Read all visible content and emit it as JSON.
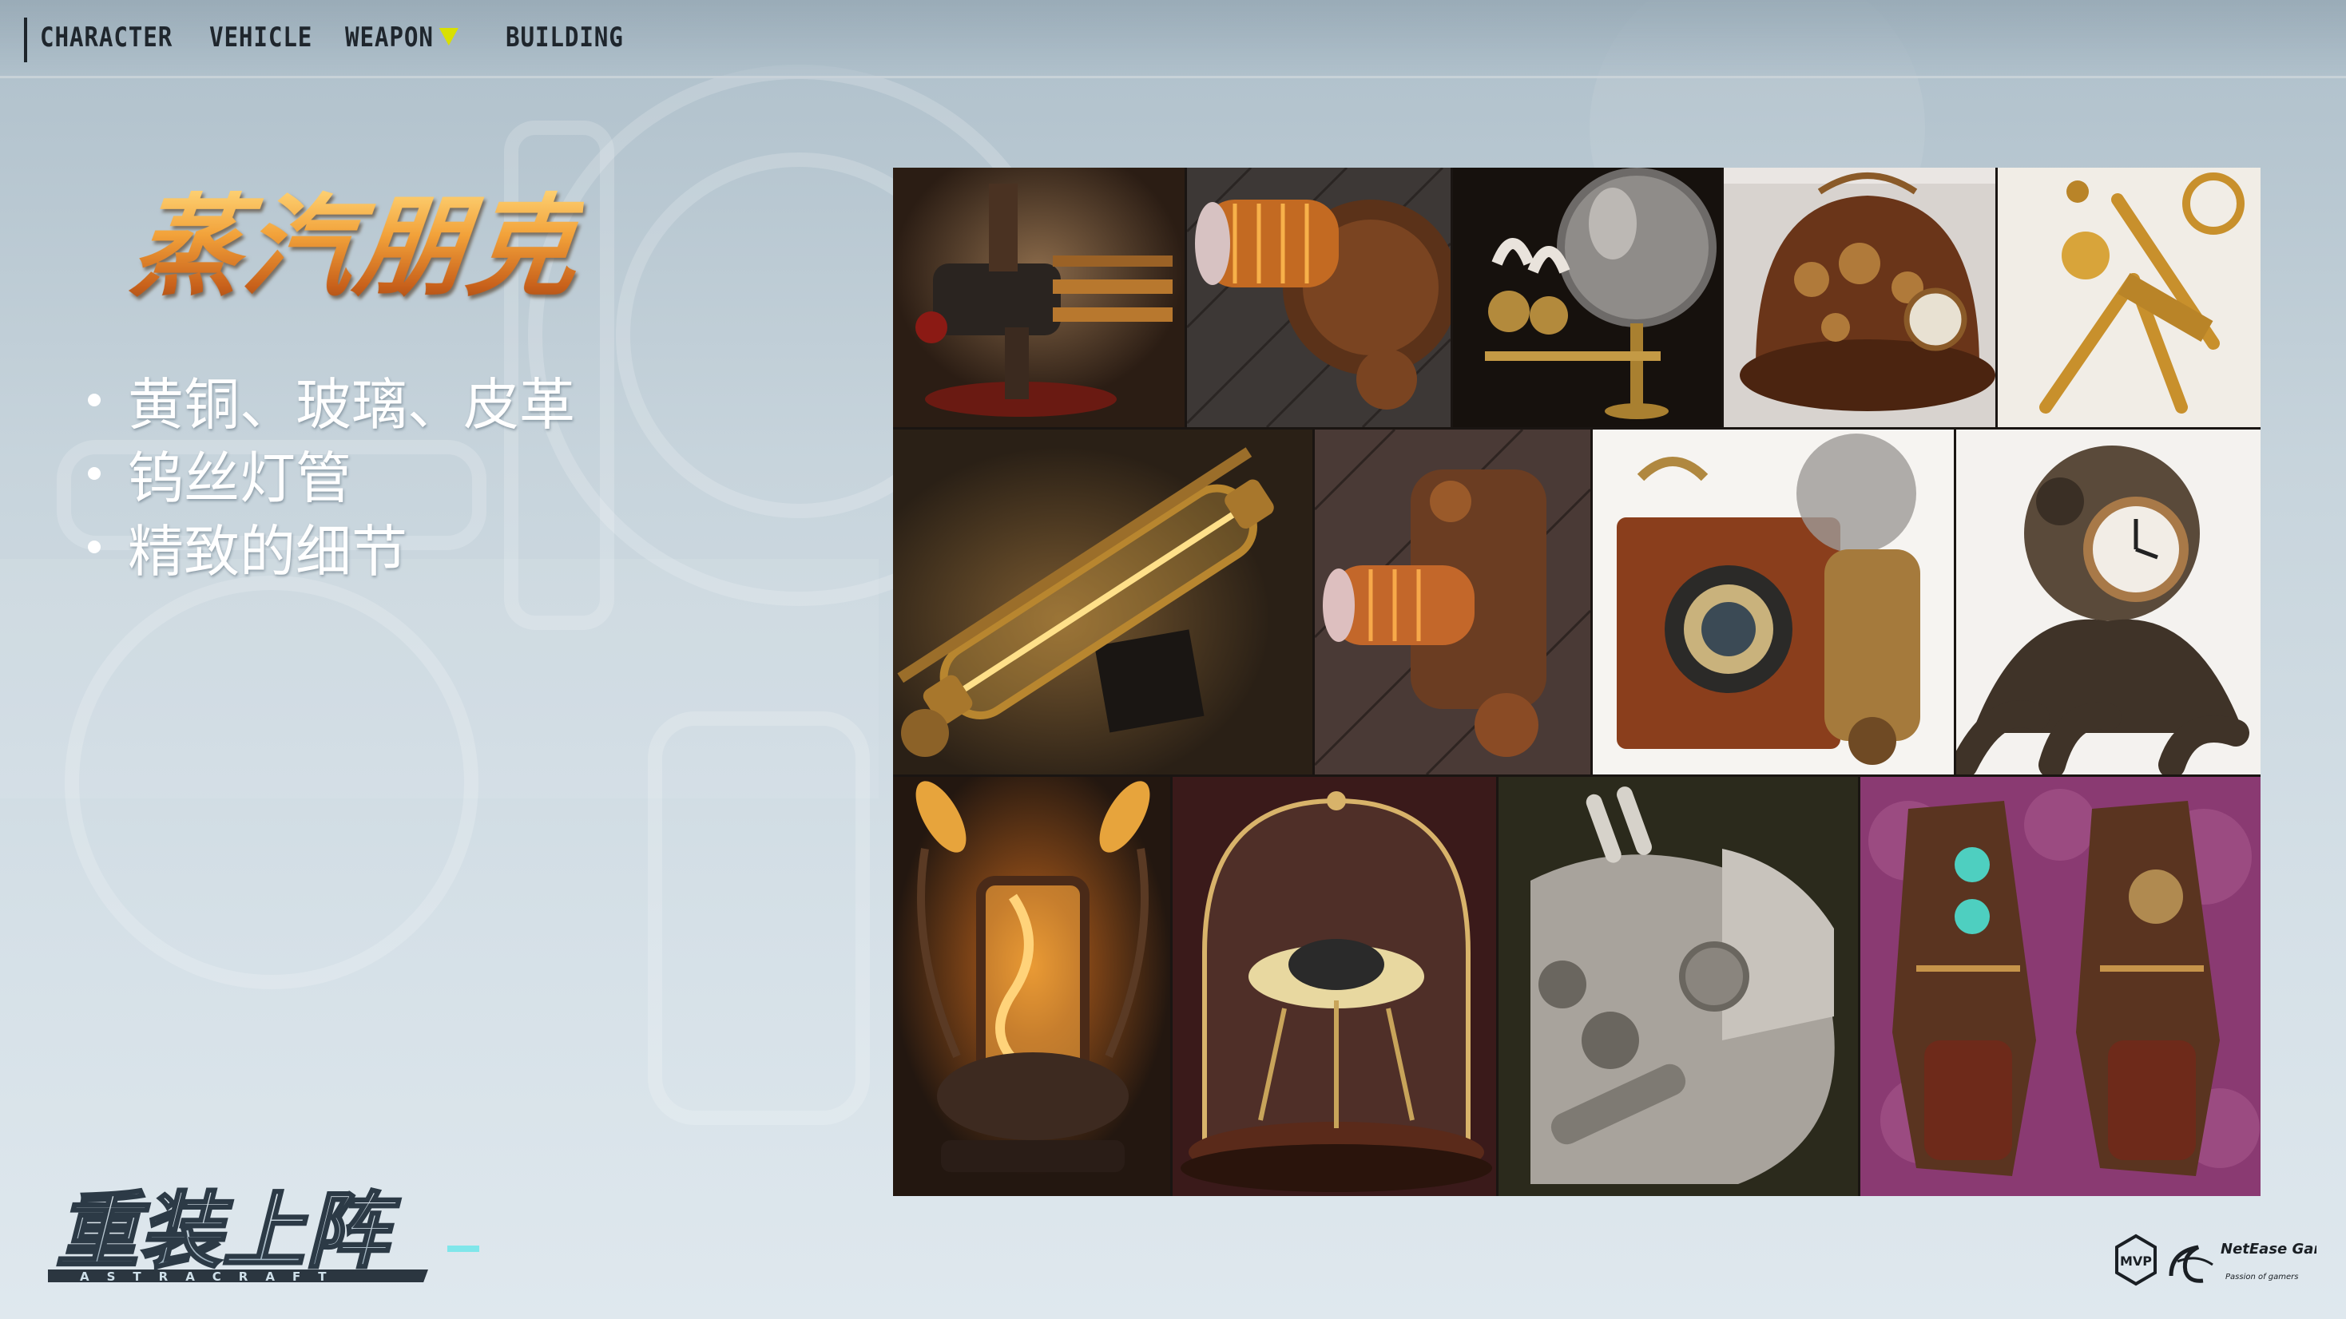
{
  "nav": {
    "items": [
      "CHARACTER",
      "VEHICLE",
      "WEAPON",
      "BUILDING"
    ],
    "active_indicator_color": "#d9e000"
  },
  "slide": {
    "title": "蒸汽朋克",
    "bullets": [
      "黄铜、玻璃、皮革",
      "钨丝灯管",
      "精致的细节"
    ]
  },
  "gallery": {
    "tiles": [
      "steampunk-lamp-pipe",
      "steampunk-wall-light",
      "steampunk-glass-globe-lamp",
      "steampunk-gear-hat",
      "brass-microscope",
      "filament-tube-wall-lamp",
      "steampunk-wall-sconce",
      "steampunk-camera",
      "diving-helmet-octopus-clock",
      "edison-bulb-table-lamp",
      "glass-dome-mechanism",
      "metal-robot-head",
      "steampunk-gauntlets"
    ]
  },
  "branding": {
    "game_logo": "重装上阵",
    "game_logo_sub": "ASTRACRAFT",
    "publisher_mark": "MVP",
    "publisher_name": "NetEase Games",
    "publisher_tagline": "Passion of gamers"
  },
  "colors": {
    "title_gold": "#e38a23",
    "text_white": "#ffffff",
    "nav_text": "#1f262d"
  }
}
